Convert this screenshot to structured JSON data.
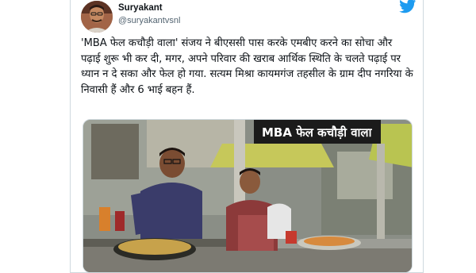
{
  "tweet": {
    "display_name": "Suryakant",
    "handle": "@suryakantvsnl",
    "text": "'MBA फेल कचौड़ी वाला'  संजय ने बीएससी पास करके एमबीए करने का सोचा और पढ़ाई शुरू भी कर दी, मगर, अपने परिवार की खराब आर्थिक स्थिति के चलते पढ़ाई पर ध्यान न दे सका और फेल हो गया. सत्यम मिश्रा कायमगंज तहसील के ग्राम दीप नगरिया के निवासी हैं और 6 भाई बहन हैं."
  },
  "media": {
    "shop_sign": "MBA फेल कचौड़ी वाला"
  },
  "icons": {
    "platform": "twitter-bird-icon",
    "avatar": "profile-photo"
  },
  "colors": {
    "twitter_blue": "#1d9bf0",
    "text_primary": "#0f1419",
    "text_secondary": "#536471",
    "border": "#cfd9de"
  }
}
